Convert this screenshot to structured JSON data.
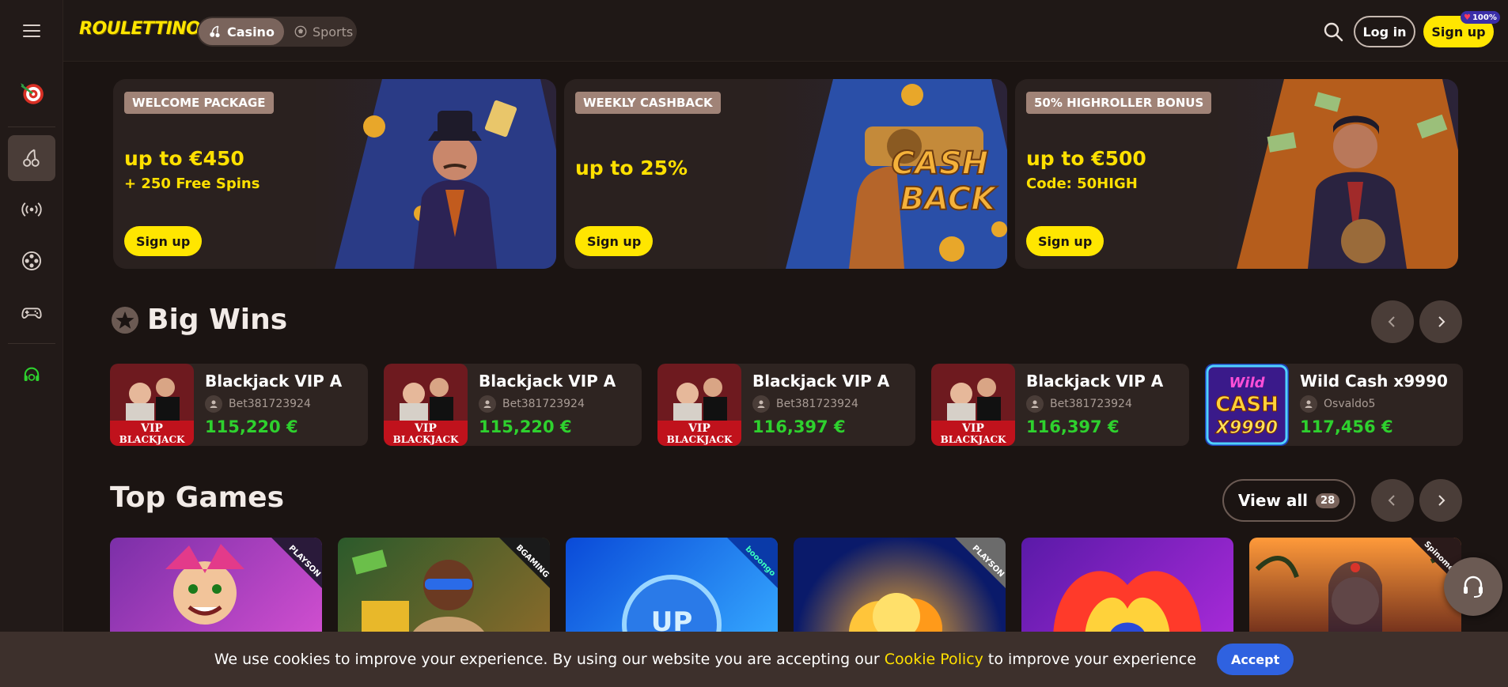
{
  "header": {
    "logo": "ROULETTINO",
    "modes": [
      {
        "label": "Casino",
        "icon": "cherry-icon",
        "active": true
      },
      {
        "label": "Sports",
        "icon": "soccer-ball-icon",
        "active": false
      }
    ],
    "login_label": "Log in",
    "signup_label": "Sign up",
    "signup_badge": "100%"
  },
  "sidebar": {
    "items": [
      "dartboard-icon",
      "cherry-icon",
      "live-broadcast-icon",
      "film-reel-icon",
      "gamepad-icon",
      "headset-icon"
    ]
  },
  "promos": [
    {
      "tag": "WELCOME PACKAGE",
      "headline": "up to €450",
      "sub": "+ 250 Free Spins",
      "button": "Sign up"
    },
    {
      "tag": "WEEKLY CASHBACK",
      "headline": "up to 25%",
      "sub": "",
      "button": "Sign up",
      "art_text": "CASH BACK"
    },
    {
      "tag": "50% HIGHROLLER BONUS",
      "headline": "up to €500",
      "sub": "Code: 50HIGH",
      "button": "Sign up"
    }
  ],
  "big_wins": {
    "title": "Big Wins",
    "items": [
      {
        "game": "Blackjack VIP A",
        "user": "Bet381723924",
        "amount": "115,220 €",
        "thumb_text": "VIP BLACKJACK"
      },
      {
        "game": "Blackjack VIP A",
        "user": "Bet381723924",
        "amount": "115,220 €",
        "thumb_text": "VIP BLACKJACK"
      },
      {
        "game": "Blackjack VIP A",
        "user": "Bet381723924",
        "amount": "116,397 €",
        "thumb_text": "VIP BLACKJACK"
      },
      {
        "game": "Blackjack VIP A",
        "user": "Bet381723924",
        "amount": "116,397 €",
        "thumb_text": "VIP BLACKJACK"
      },
      {
        "game": "Wild Cash x9990",
        "user": "Osvaldo5",
        "amount": "117,456 €",
        "thumb_text": "Wild CASH X9990"
      }
    ]
  },
  "top_games": {
    "title": "Top Games",
    "view_all_label": "View all",
    "view_all_count": "28",
    "providers": [
      "PLAYSON",
      "BGAMING",
      "booongo",
      "PLAYSON",
      "",
      "Spinomenal"
    ]
  },
  "cookie": {
    "text_before": "We use cookies to improve your experience. By using our website you are accepting our",
    "link": "Cookie Policy",
    "text_after": "to improve your experience",
    "accept": "Accept"
  },
  "colors": {
    "accent_yellow": "#ffe600",
    "win_green": "#2ed12e",
    "accept_blue": "#2f62e0"
  }
}
